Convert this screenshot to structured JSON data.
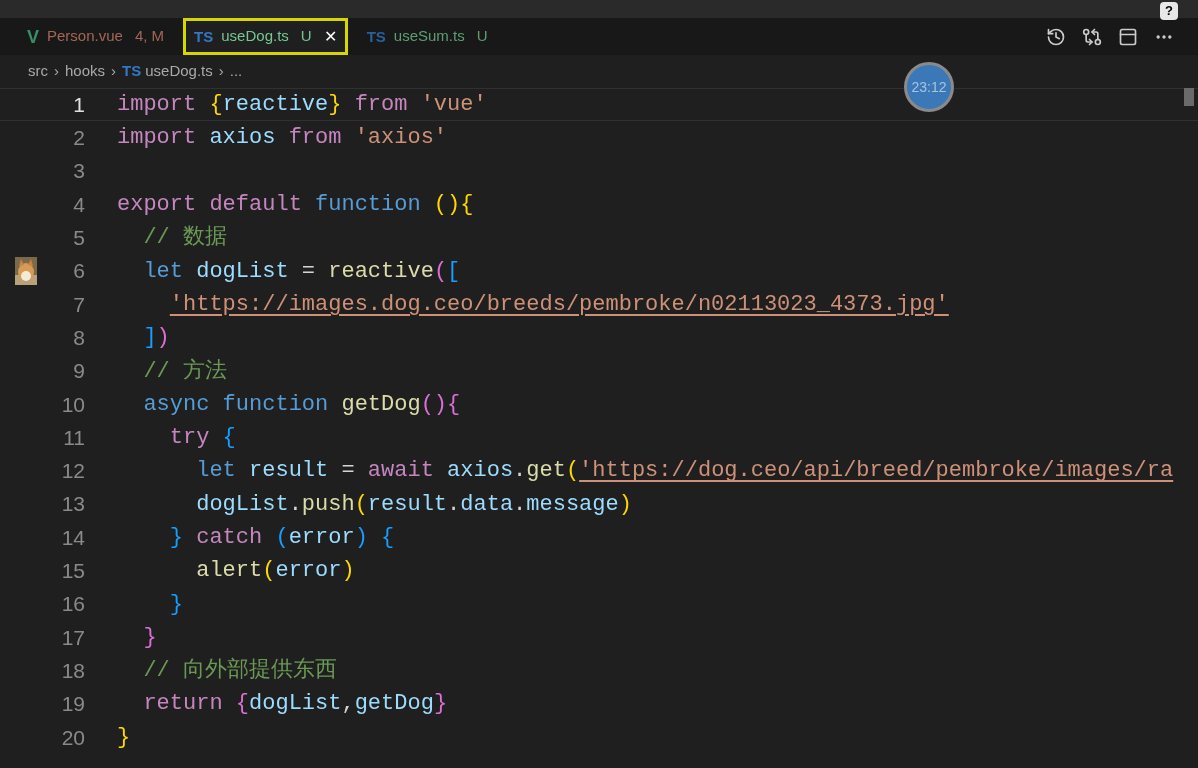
{
  "tabs": [
    {
      "icon": "V",
      "kind": "vue",
      "label": "Person.vue",
      "status": "4, M",
      "selected": false,
      "highlighted": false
    },
    {
      "icon": "TS",
      "kind": "ts",
      "label": "useDog.ts",
      "status": "U",
      "selected": true,
      "highlighted": true,
      "close": "✕"
    },
    {
      "icon": "TS",
      "kind": "ts",
      "label": "useSum.ts",
      "status": "U",
      "selected": false,
      "highlighted": false
    }
  ],
  "help": "?",
  "breadcrumb": [
    {
      "text": "src"
    },
    {
      "sep": "›",
      "text": "hooks"
    },
    {
      "sep": "›",
      "icon": "TS",
      "text": "useDog.ts"
    },
    {
      "sep": "›",
      "text": "..."
    }
  ],
  "timer": "23:12",
  "lines": [
    {
      "number": "1",
      "current": true,
      "tokens": [
        {
          "kind": "ctrl",
          "text": "import"
        },
        {
          "kind": "b1",
          "text": " {"
        },
        {
          "kind": "var",
          "text": "reactive"
        },
        {
          "kind": "b1",
          "text": "}"
        },
        {
          "kind": "ctrl",
          "text": " from"
        },
        {
          "kind": "str",
          "text": " 'vue'"
        }
      ]
    },
    {
      "number": "2",
      "current": false,
      "tokens": [
        {
          "kind": "ctrl",
          "text": "import"
        },
        {
          "kind": "var",
          "text": " axios "
        },
        {
          "kind": "ctrl",
          "text": "from"
        },
        {
          "kind": "str",
          "text": " 'axios'"
        }
      ]
    },
    {
      "number": "3",
      "current": false
    },
    {
      "number": "4",
      "current": false,
      "tokens": [
        {
          "kind": "ctrl",
          "text": "export default"
        },
        {
          "kind": "kw",
          "text": " function"
        },
        {
          "kind": "b1",
          "text": " (){"
        }
      ]
    },
    {
      "number": "5",
      "current": false,
      "tokens": [
        {
          "kind": "cmt",
          "text": "  // 数据"
        }
      ]
    },
    {
      "number": "6",
      "current": false,
      "thumbnail": true,
      "tokens": [
        {
          "kind": "kw",
          "text": "  let"
        },
        {
          "kind": "var",
          "text": " dogList"
        },
        {
          "kind": "plain",
          "text": " = "
        },
        {
          "kind": "fn",
          "text": "reactive"
        },
        {
          "kind": "b2",
          "text": "("
        },
        {
          "kind": "b3",
          "text": "["
        }
      ]
    },
    {
      "number": "7",
      "current": false,
      "tokens": [
        {
          "kind": "url",
          "text": "    'https://images.dog.ceo/breeds/pembroke/n02113023_4373.jpg'"
        }
      ]
    },
    {
      "number": "8",
      "current": false,
      "tokens": [
        {
          "kind": "b3",
          "text": "  ]"
        },
        {
          "kind": "b2",
          "text": ")"
        }
      ]
    },
    {
      "number": "9",
      "current": false,
      "tokens": [
        {
          "kind": "cmt",
          "text": "  // 方法"
        }
      ]
    },
    {
      "number": "10",
      "current": false,
      "tokens": [
        {
          "kind": "kw",
          "text": "  async function"
        },
        {
          "kind": "fn",
          "text": " getDog"
        },
        {
          "kind": "b2",
          "text": "(){"
        }
      ]
    },
    {
      "number": "11",
      "current": false,
      "tokens": [
        {
          "kind": "ctrl",
          "text": "    try"
        },
        {
          "kind": "b3",
          "text": " {"
        }
      ]
    },
    {
      "number": "12",
      "current": false,
      "tokens": [
        {
          "kind": "kw",
          "text": "      let"
        },
        {
          "kind": "var",
          "text": " result"
        },
        {
          "kind": "plain",
          "text": " = "
        },
        {
          "kind": "ctrl",
          "text": "await"
        },
        {
          "kind": "var",
          "text": " axios"
        },
        {
          "kind": "plain",
          "text": "."
        },
        {
          "kind": "fn",
          "text": "get"
        },
        {
          "kind": "b1",
          "text": "("
        },
        {
          "kind": "url",
          "text": "'https://dog.ceo/api/breed/pembroke/images/ra"
        }
      ]
    },
    {
      "number": "13",
      "current": false,
      "tokens": [
        {
          "kind": "var",
          "text": "      dogList"
        },
        {
          "kind": "plain",
          "text": "."
        },
        {
          "kind": "fn",
          "text": "push"
        },
        {
          "kind": "b1",
          "text": "("
        },
        {
          "kind": "var",
          "text": "result"
        },
        {
          "kind": "plain",
          "text": "."
        },
        {
          "kind": "var",
          "text": "data"
        },
        {
          "kind": "plain",
          "text": "."
        },
        {
          "kind": "var",
          "text": "message"
        },
        {
          "kind": "b1",
          "text": ")"
        }
      ]
    },
    {
      "number": "14",
      "current": false,
      "tokens": [
        {
          "kind": "b3",
          "text": "    }"
        },
        {
          "kind": "ctrl",
          "text": " catch"
        },
        {
          "kind": "b3",
          "text": " ("
        },
        {
          "kind": "var",
          "text": "error"
        },
        {
          "kind": "b3",
          "text": ")"
        },
        {
          "kind": "b3",
          "text": " {"
        }
      ]
    },
    {
      "number": "15",
      "current": false,
      "tokens": [
        {
          "kind": "fn",
          "text": "      alert"
        },
        {
          "kind": "b1",
          "text": "("
        },
        {
          "kind": "var",
          "text": "error"
        },
        {
          "kind": "b1",
          "text": ")"
        }
      ]
    },
    {
      "number": "16",
      "current": false,
      "tokens": [
        {
          "kind": "b3",
          "text": "    }"
        }
      ]
    },
    {
      "number": "17",
      "current": false,
      "tokens": [
        {
          "kind": "b2",
          "text": "  }"
        }
      ]
    },
    {
      "number": "18",
      "current": false,
      "tokens": [
        {
          "kind": "cmt",
          "text": "  // 向外部提供东西"
        }
      ]
    },
    {
      "number": "19",
      "current": false,
      "tokens": [
        {
          "kind": "ctrl",
          "text": "  return"
        },
        {
          "kind": "b2",
          "text": " {"
        },
        {
          "kind": "var",
          "text": "dogList"
        },
        {
          "kind": "plain",
          "text": ","
        },
        {
          "kind": "var",
          "text": "getDog"
        },
        {
          "kind": "b2",
          "text": "}"
        }
      ]
    },
    {
      "number": "20",
      "current": false,
      "tokens": [
        {
          "kind": "b1",
          "text": "}"
        }
      ]
    }
  ]
}
